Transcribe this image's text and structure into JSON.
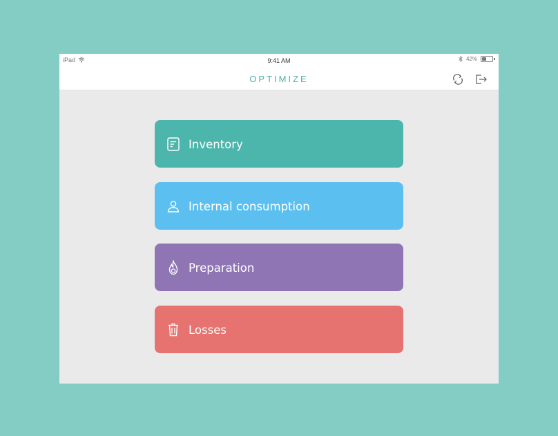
{
  "status_bar": {
    "device": "iPad",
    "time": "9:41 AM",
    "battery_label": "42%",
    "battery_level": 0.42
  },
  "navbar": {
    "logo": "OPTIMIZE",
    "sync_icon": "refresh-icon",
    "logout_icon": "logout-icon"
  },
  "menu": [
    {
      "label": "Inventory",
      "icon": "clipboard-icon",
      "color": "#4db6ac"
    },
    {
      "label": "Internal consumption",
      "icon": "person-icon",
      "color": "#5bc0f0"
    },
    {
      "label": "Preparation",
      "icon": "flame-icon",
      "color": "#9075b5"
    },
    {
      "label": "Losses",
      "icon": "trash-icon",
      "color": "#e67370"
    }
  ],
  "colors": {
    "background": "#84cdc5",
    "content": "#eaeaea",
    "brand": "#4bb2aa"
  }
}
